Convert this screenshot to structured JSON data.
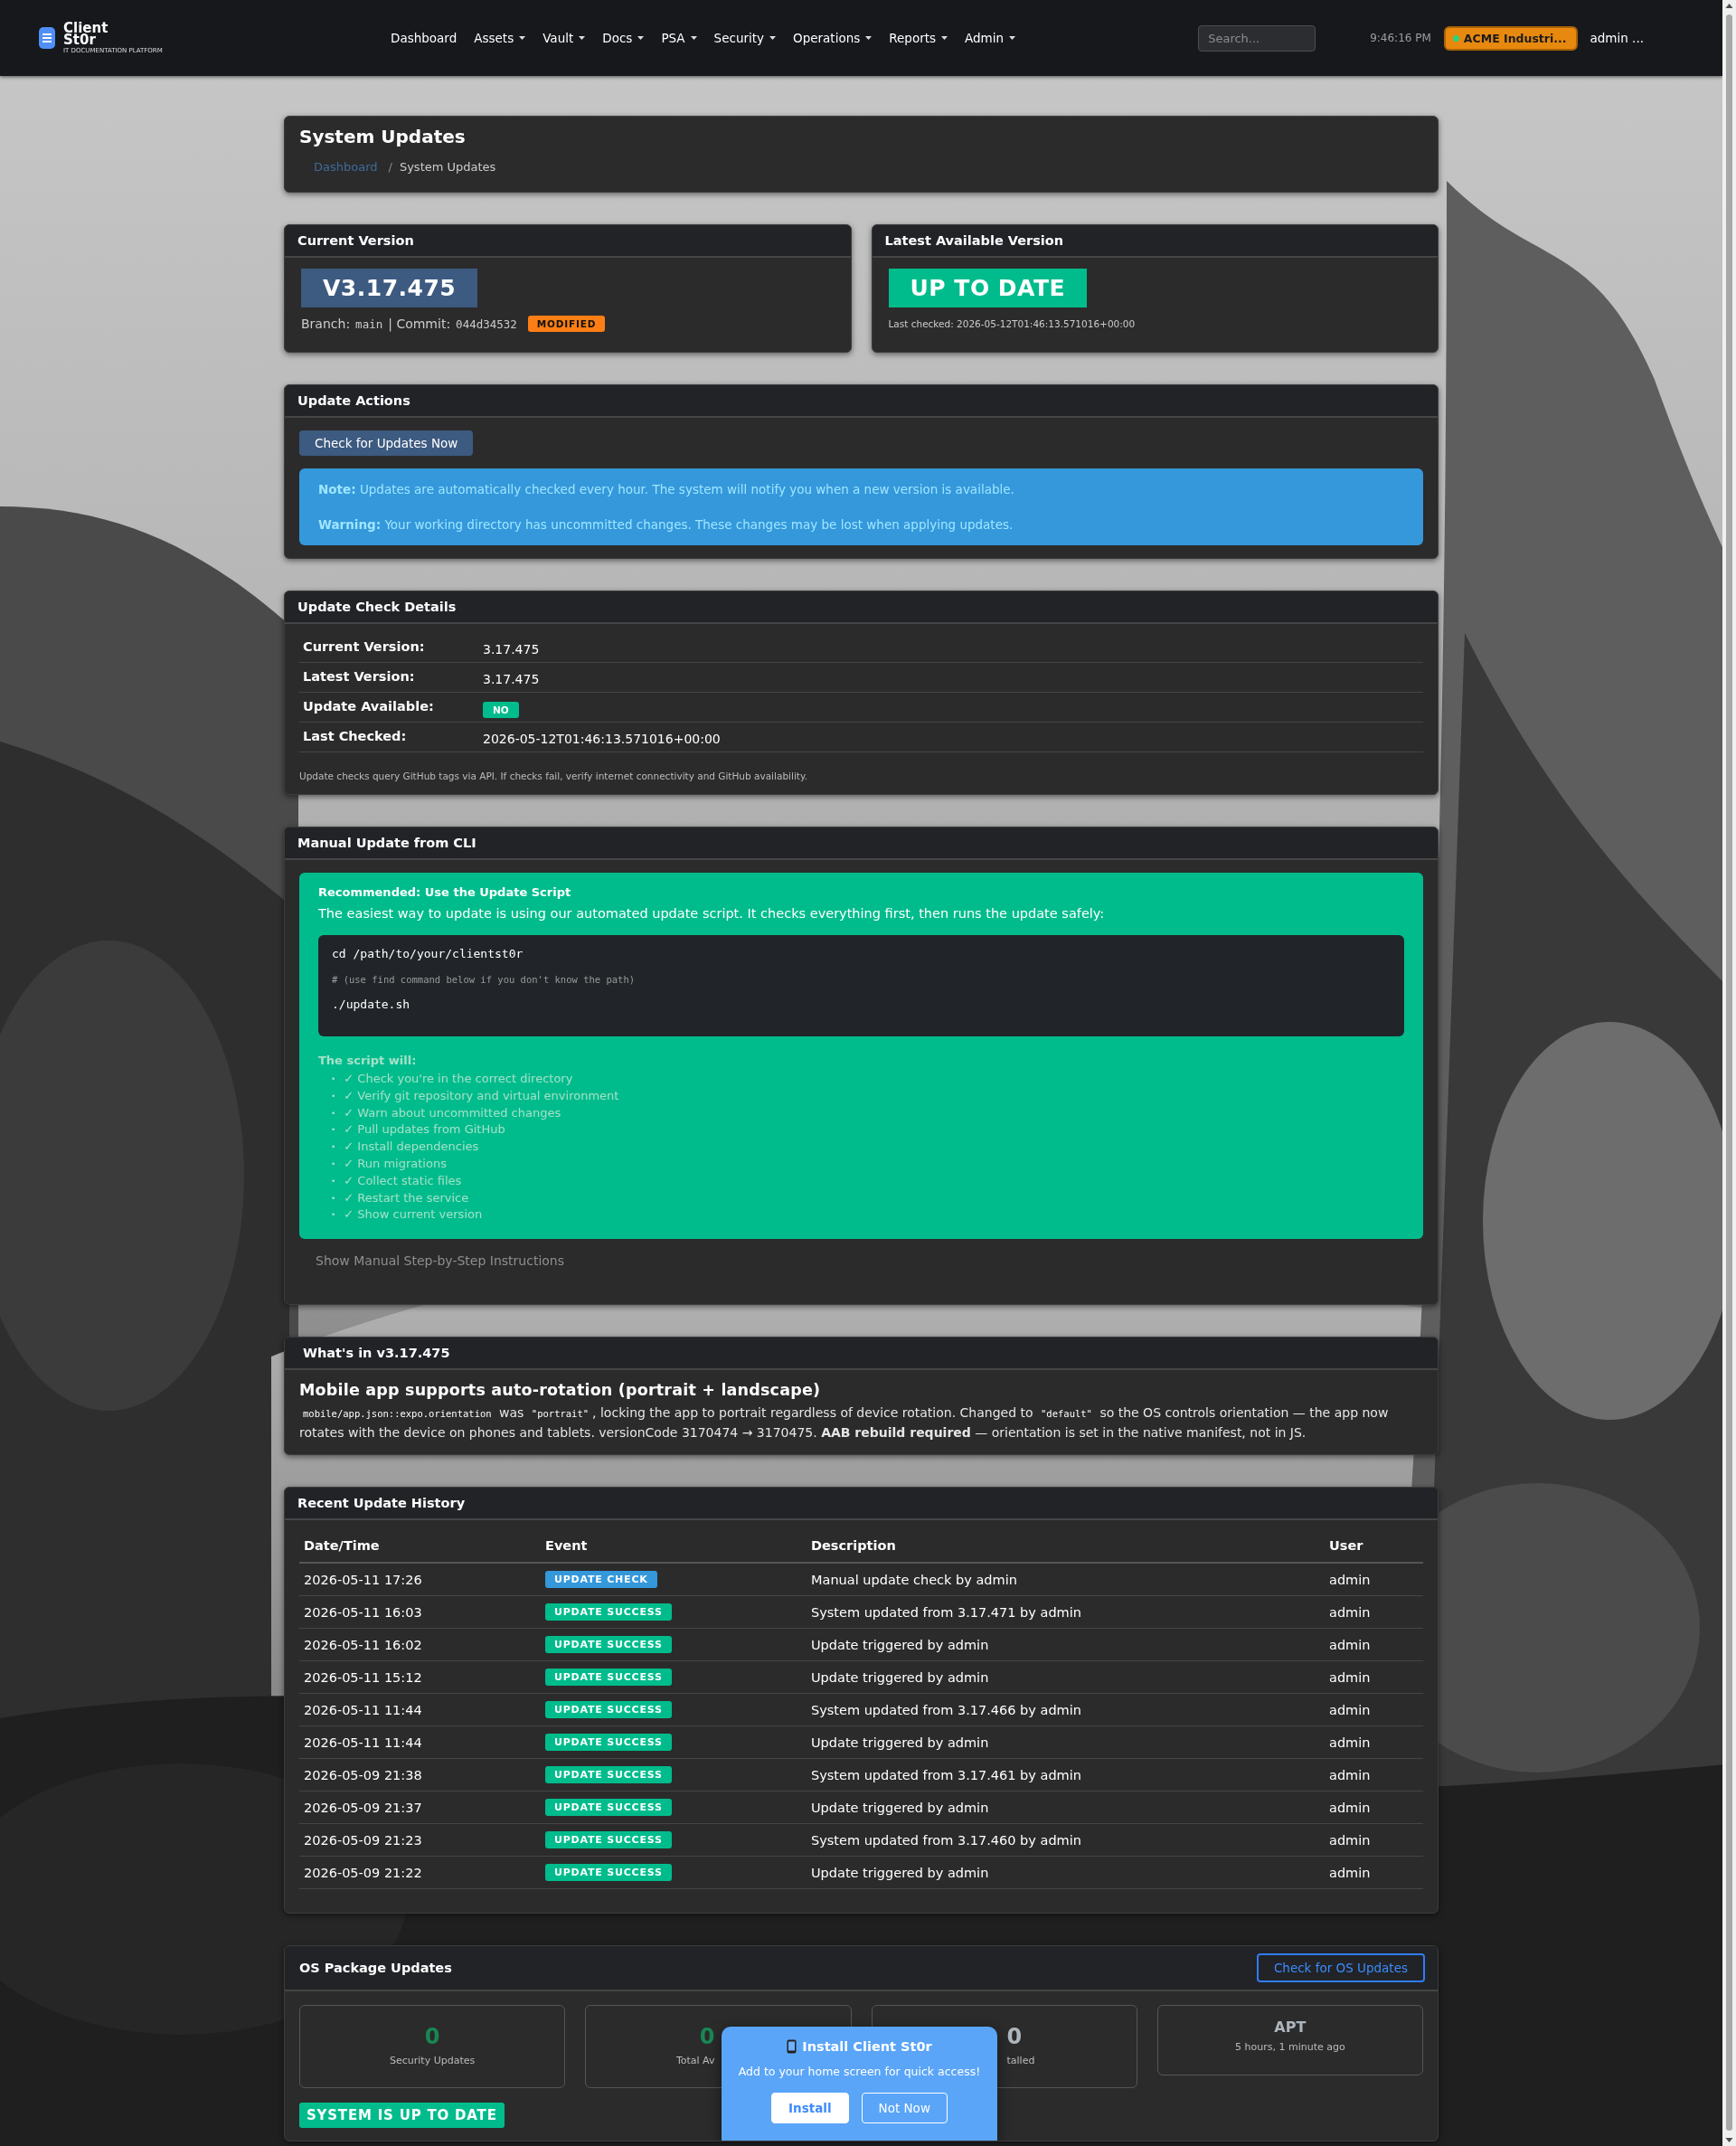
{
  "nav": {
    "brand": {
      "name_top": "Client",
      "name_bottom": "St0r",
      "tagline": "IT DOCUMENTATION PLATFORM"
    },
    "items": [
      {
        "label": "Dashboard",
        "dropdown": false
      },
      {
        "label": "Assets",
        "dropdown": true
      },
      {
        "label": "Vault",
        "dropdown": true
      },
      {
        "label": "Docs",
        "dropdown": true
      },
      {
        "label": "PSA",
        "dropdown": true
      },
      {
        "label": "Security",
        "dropdown": true
      },
      {
        "label": "Operations",
        "dropdown": true
      },
      {
        "label": "Reports",
        "dropdown": true
      },
      {
        "label": "Admin",
        "dropdown": true
      }
    ],
    "search": {
      "placeholder": "Search..."
    },
    "clock": "9:46:16 PM",
    "organization": "ACME Industri...",
    "user": "admin ..."
  },
  "page": {
    "title": "System Updates",
    "breadcrumb_separator": "/",
    "breadcrumb": [
      {
        "label": "Dashboard",
        "link": true
      },
      {
        "label": "System Updates",
        "link": false
      }
    ]
  },
  "current_version": {
    "title": "Current Version",
    "version": "V3.17.475",
    "branch_label": "Branch:",
    "branch": "main",
    "commit_label": "| Commit:",
    "commit": "044d34532",
    "badge": "MODIFIED"
  },
  "latest_version": {
    "title": "Latest Available Version",
    "status": "UP TO DATE",
    "last_checked": "Last checked: 2026-05-12T01:46:13.571016+00:00"
  },
  "update_actions": {
    "title": "Update Actions",
    "button": "Check for Updates Now",
    "notes": [
      {
        "label": "Note:",
        "text": "Updates are automatically checked every hour. The system will notify you when a new version is available."
      },
      {
        "label": "Warning:",
        "text": "Your working directory has uncommitted changes. These changes may be lost when applying updates."
      }
    ]
  },
  "details": {
    "title": "Update Check Details",
    "rows": [
      {
        "label": "Current Version:",
        "value": "3.17.475",
        "kind": "text"
      },
      {
        "label": "Latest Version:",
        "value": "3.17.475",
        "kind": "text"
      },
      {
        "label": "Update Available:",
        "value": "NO",
        "kind": "badge"
      },
      {
        "label": "Last Checked:",
        "value": "2026-05-12T01:46:13.571016+00:00",
        "kind": "text"
      }
    ],
    "footnote": "Update checks query GitHub tags via API. If checks fail, verify internet connectivity and GitHub availability."
  },
  "cli": {
    "title": "Manual Update from CLI",
    "heading": "Recommended: Use the Update Script",
    "intro": "The easiest way to update is using our automated update script. It checks everything first, then runs the update safely:",
    "code": [
      {
        "text": "cd /path/to/your/clientst0r",
        "kind": "command"
      },
      {
        "text": "# (use find command below if you don't know the path)",
        "kind": "comment"
      },
      {
        "text": "./update.sh",
        "kind": "command"
      }
    ],
    "list_title": "The script will:",
    "list_marker": "•",
    "steps": [
      "✓ Check you're in the correct directory",
      "✓ Verify git repository and virtual environment",
      "✓ Warn about uncommitted changes",
      "✓ Pull updates from GitHub",
      "✓ Install dependencies",
      "✓ Run migrations",
      "✓ Collect static files",
      "✓ Restart the service",
      "✓ Show current version"
    ],
    "toggle": "Show Manual Step-by-Step Instructions"
  },
  "whats_new": {
    "title": "What's in v3.17.475",
    "heading": "Mobile app supports auto-rotation (portrait + landscape)",
    "body": [
      {
        "text": "mobile/app.json::expo.orientation",
        "kind": "code"
      },
      {
        "text": " was ",
        "kind": "text"
      },
      {
        "text": "\"portrait\"",
        "kind": "code"
      },
      {
        "text": ", locking the app to portrait regardless of device rotation. Changed to ",
        "kind": "text"
      },
      {
        "text": "\"default\"",
        "kind": "code"
      },
      {
        "text": " so the OS controls orientation — the app now rotates with the device on phones and tablets. versionCode 3170474 → 3170475. **AAB rebuild required** — orientation is set in the native manifest, not in JS.",
        "kind": "text"
      }
    ]
  },
  "history": {
    "title": "Recent Update History",
    "columns": [
      "Date/Time",
      "Event",
      "Description",
      "User"
    ],
    "rows": [
      {
        "datetime": "2026-05-11 17:26",
        "event": "UPDATE CHECK",
        "kind": "check",
        "description": "Manual update check by admin",
        "user": "admin"
      },
      {
        "datetime": "2026-05-11 16:03",
        "event": "UPDATE SUCCESS",
        "kind": "success",
        "description": "System updated from 3.17.471 by admin",
        "user": "admin"
      },
      {
        "datetime": "2026-05-11 16:02",
        "event": "UPDATE SUCCESS",
        "kind": "success",
        "description": "Update triggered by admin",
        "user": "admin"
      },
      {
        "datetime": "2026-05-11 15:12",
        "event": "UPDATE SUCCESS",
        "kind": "success",
        "description": "Update triggered by admin",
        "user": "admin"
      },
      {
        "datetime": "2026-05-11 11:44",
        "event": "UPDATE SUCCESS",
        "kind": "success",
        "description": "System updated from 3.17.466 by admin",
        "user": "admin"
      },
      {
        "datetime": "2026-05-11 11:44",
        "event": "UPDATE SUCCESS",
        "kind": "success",
        "description": "Update triggered by admin",
        "user": "admin"
      },
      {
        "datetime": "2026-05-09 21:38",
        "event": "UPDATE SUCCESS",
        "kind": "success",
        "description": "System updated from 3.17.461 by admin",
        "user": "admin"
      },
      {
        "datetime": "2026-05-09 21:37",
        "event": "UPDATE SUCCESS",
        "kind": "success",
        "description": "Update triggered by admin",
        "user": "admin"
      },
      {
        "datetime": "2026-05-09 21:23",
        "event": "UPDATE SUCCESS",
        "kind": "success",
        "description": "System updated from 3.17.460 by admin",
        "user": "admin"
      },
      {
        "datetime": "2026-05-09 21:22",
        "event": "UPDATE SUCCESS",
        "kind": "success",
        "description": "Update triggered by admin",
        "user": "admin"
      }
    ]
  },
  "os_packages": {
    "title": "OS Package Updates",
    "button": "Check for OS Updates",
    "stats": [
      {
        "value": "0",
        "label": "Security Updates",
        "color": "#198754"
      },
      {
        "value": "0",
        "label": "Total Av",
        "color": "#198754"
      },
      {
        "value": "0",
        "label": "talled",
        "color": "#adb5bd"
      },
      {
        "value": "APT",
        "label": "5 hours, 1 minute ago",
        "color": "#adb5bd"
      }
    ],
    "status": "SYSTEM IS UP TO DATE"
  },
  "install_prompt": {
    "title": "Install Client St0r",
    "text": "Add to your home screen for quick access!",
    "buttons": [
      {
        "label": "Install",
        "primary": true
      },
      {
        "label": "Not Now",
        "primary": false
      }
    ]
  }
}
